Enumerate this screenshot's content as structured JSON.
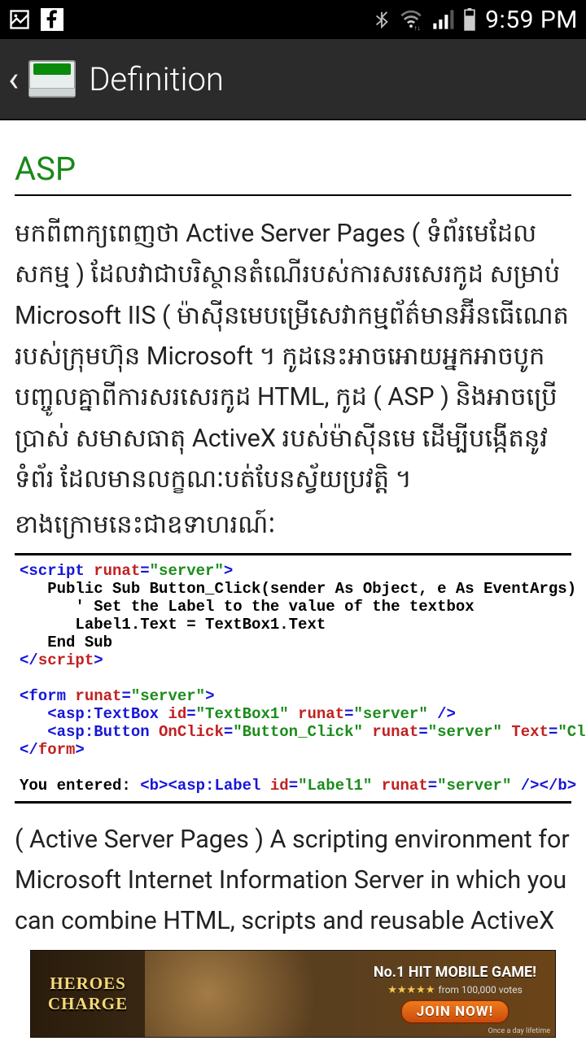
{
  "status": {
    "time": "9:59 PM"
  },
  "appbar": {
    "title": "Definition"
  },
  "article": {
    "term": "ASP",
    "khmer_body": "មកពីពាក្យពេញថា Active Server Pages ( ទំព័រមេដែលសកម្ម ) ដែលវាជាបរិស្ថានតំណើរបស់ការសរសេរកូដ សម្រាប់ Microsoft IIS ( ម៉ាស៊ីនមេបម្រើសេវាកម្មព័ត៌មានអ៊ីនធើណេត របស់ក្រុមហ៊ុន Microsoft ។ កូដនេះអាចអោយអ្នកអាចបូកបញ្ចូលគ្នាពីការសរសេរកូដ HTML, កូដ ( ASP ) និងអាចប្រើប្រាស់ សមាសធាតុ ActiveX របស់ម៉ាស៊ីនមេ ដើម្បីបង្កើតនូវទំព័រ ដែលមានលក្ខណៈបត់បែនស្វ័យប្រវត្តិ ។",
    "khmer_example_intro": "ខាងក្រោមនេះជាឧទាហរណ៍ៈ",
    "english_body": "( Active Server Pages ) A scripting environment for Microsoft Internet Information Server in which you can combine HTML, scripts and reusable ActiveX server"
  },
  "code": {
    "l1a": "<script ",
    "l1b": "runat",
    "l1c": "=",
    "l1d": "\"server\"",
    "l1e": ">",
    "l2": "   Public Sub Button_Click(sender As Object, e As EventArgs)",
    "l3": "      ' Set the Label to the value of the textbox",
    "l4": "      Label1.Text = TextBox1.Text",
    "l5": "   End Sub",
    "l6a": "</",
    "l6b": "script",
    "l6c": ">",
    "l7a": "<form ",
    "l7b": "runat",
    "l7c": "=",
    "l7d": "\"server\"",
    "l7e": ">",
    "l8a": "   <asp:TextBox ",
    "l8b": "id",
    "l8c": "=",
    "l8d": "\"TextBox1\"",
    "l8e": " ",
    "l8f": "runat",
    "l8g": "=",
    "l8h": "\"server\"",
    "l8i": " />",
    "l9a": "   <asp:Button ",
    "l9b": "OnClick",
    "l9c": "=",
    "l9d": "\"Button_Click\"",
    "l9e": " ",
    "l9f": "runat",
    "l9g": "=",
    "l9h": "\"server\"",
    "l9i": " ",
    "l9j": "Text",
    "l9k": "=",
    "l9l": "\"Click Me!\"",
    "l9m": "/>",
    "l10a": "</",
    "l10b": "form",
    "l10c": ">",
    "l11a": "You entered: ",
    "l11b": "<b><asp:Label ",
    "l11c": "id",
    "l11d": "=",
    "l11e": "\"Label1\"",
    "l11f": " ",
    "l11g": "runat",
    "l11h": "=",
    "l11i": "\"server\"",
    "l11j": " /></b>"
  },
  "ad": {
    "logo_l1": "HEROES",
    "logo_l2": "CHARGE",
    "tagline": "No.1 HIT MOBILE GAME!",
    "stars": "★★★★★",
    "sub": "from 100,000 votes",
    "cta": "JOIN NOW!",
    "disclaim": "Once a day lifetime"
  }
}
